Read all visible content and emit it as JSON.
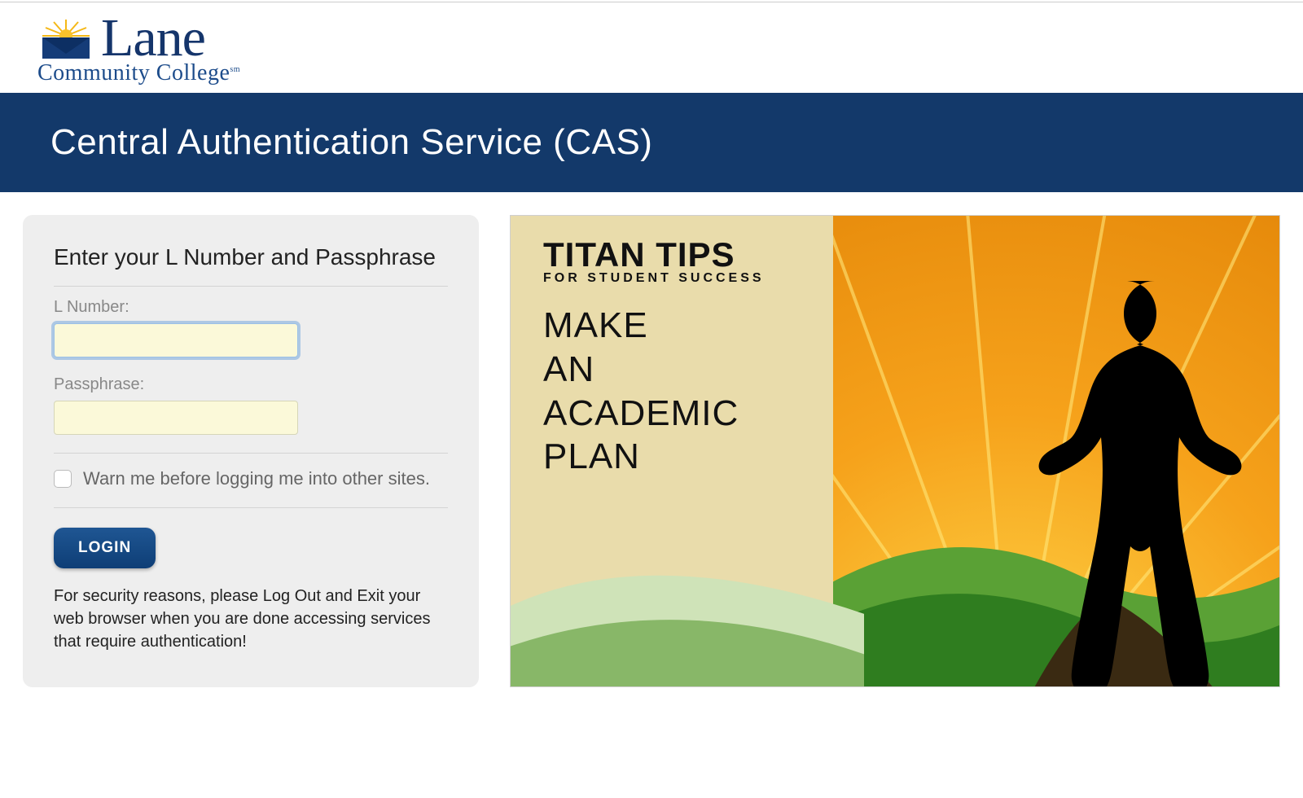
{
  "logo": {
    "word": "Lane",
    "subtitle": "Community College",
    "sm": "sm"
  },
  "banner": {
    "title": "Central Authentication Service (CAS)"
  },
  "login": {
    "heading": "Enter your L Number and Passphrase",
    "lnumber_label": "L Number:",
    "lnumber_value": "",
    "passphrase_label": "Passphrase:",
    "passphrase_value": "",
    "warn_label": "Warn me before logging me into other sites.",
    "button_label": "LOGIN",
    "security_note": "For security reasons, please Log Out and Exit your web browser when you are done accessing services that require authentication!"
  },
  "promo": {
    "title": "TITAN TIPS",
    "subtitle": "FOR STUDENT SUCCESS",
    "message_lines": [
      "MAKE",
      "AN",
      "ACADEMIC",
      "PLAN"
    ]
  }
}
